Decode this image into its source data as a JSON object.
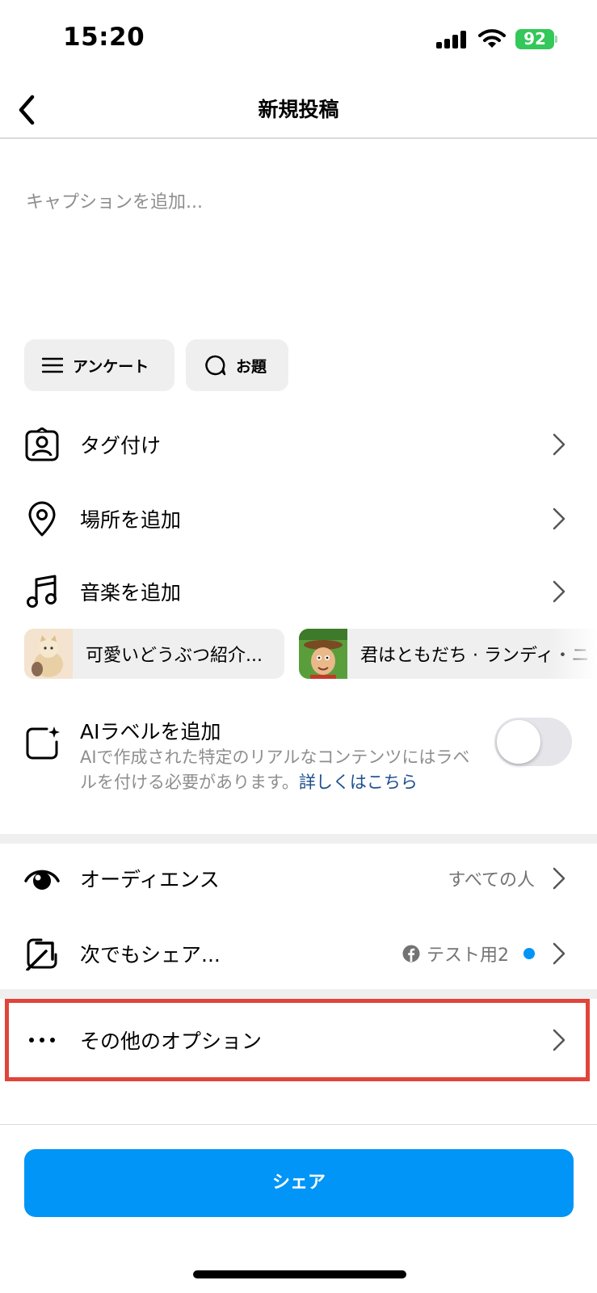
{
  "status_bar": {
    "time": "15:20",
    "battery": "92"
  },
  "header": {
    "title": "新規投稿"
  },
  "caption": {
    "placeholder": "キャプションを追加..."
  },
  "chips": {
    "poll": "アンケート",
    "prompt": "お題"
  },
  "rows": {
    "tag_people": "タグ付け",
    "add_location": "場所を追加",
    "add_music": "音楽を追加",
    "audience": "オーディエンス",
    "audience_value": "すべての人",
    "also_share": "次でもシェア...",
    "also_share_value": "テスト用2",
    "more_options": "その他のオプション"
  },
  "music_suggestions": [
    {
      "label": "可愛いどうぶつ紹介..."
    },
    {
      "label": "君はともだち · ランディ・ニ"
    }
  ],
  "ai_label": {
    "title": "AIラベルを追加",
    "description": "AIで作成された特定のリアルなコンテンツにはラベルを付ける必要があります。",
    "link": "詳しくはこちら",
    "enabled": false
  },
  "share_button": "シェア",
  "colors": {
    "accent": "#0095f6",
    "highlight": "#e0443a",
    "link": "#1d4f91",
    "battery": "#34c759"
  }
}
